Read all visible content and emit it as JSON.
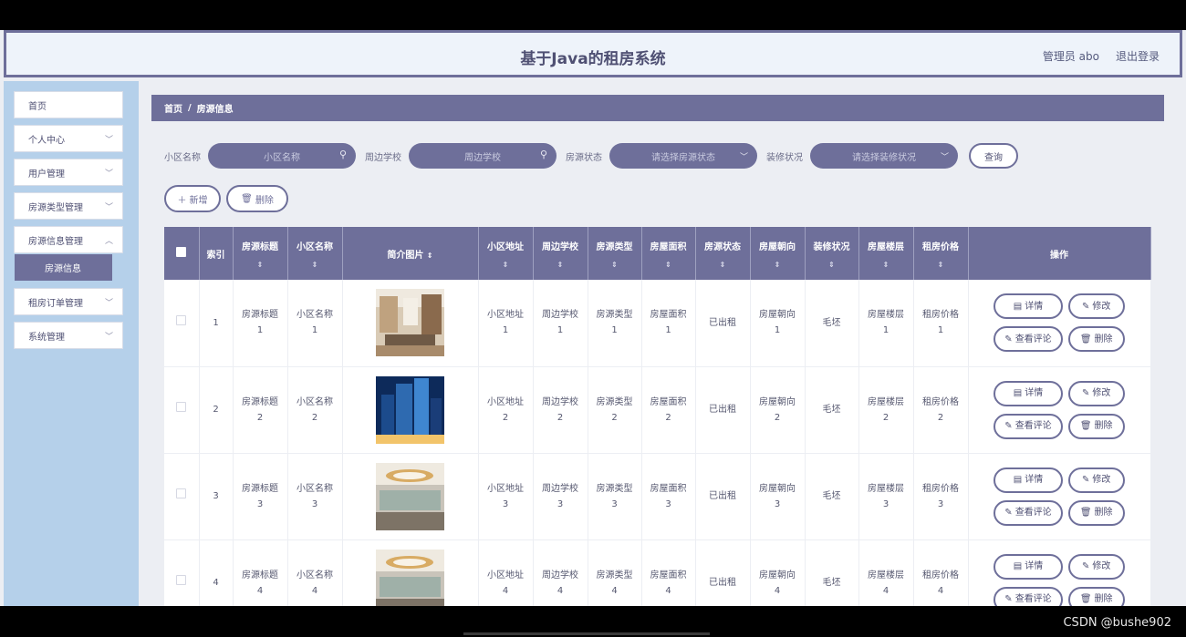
{
  "header": {
    "title": "基于Java的租房系统",
    "user_label": "管理员 abo",
    "logout_label": "退出登录"
  },
  "sidebar": {
    "items": [
      {
        "label": "首页",
        "has_chevron": false
      },
      {
        "label": "个人中心",
        "has_chevron": true
      },
      {
        "label": "用户管理",
        "has_chevron": true
      },
      {
        "label": "房源类型管理",
        "has_chevron": true
      },
      {
        "label": "房源信息管理",
        "has_chevron": true
      },
      {
        "label": "租房订单管理",
        "has_chevron": true
      },
      {
        "label": "系统管理",
        "has_chevron": true
      }
    ],
    "active_sub": "房源信息"
  },
  "breadcrumb": {
    "home": "首页",
    "separator": "/",
    "current": "房源信息"
  },
  "search": {
    "community_label": "小区名称",
    "community_placeholder": "小区名称",
    "school_label": "周边学校",
    "school_placeholder": "周边学校",
    "status_label": "房源状态",
    "status_placeholder": "请选择房源状态",
    "decor_label": "装修状况",
    "decor_placeholder": "请选择装修状况",
    "query_label": "查询"
  },
  "actions": {
    "add_label": "新增",
    "delete_label": "删除"
  },
  "table": {
    "headers": {
      "index": "索引",
      "title": "房源标题",
      "community": "小区名称",
      "image": "简介图片",
      "address": "小区地址",
      "school": "周边学校",
      "type": "房源类型",
      "area": "房屋面积",
      "status": "房源状态",
      "orientation": "房屋朝向",
      "decor": "装修状况",
      "floor": "房屋楼层",
      "price": "租房价格",
      "ops": "操作"
    },
    "ops_labels": {
      "detail": "详情",
      "edit": "修改",
      "comments": "查看评论",
      "delete": "删除"
    },
    "rows": [
      {
        "index": "1",
        "title": "房源标题",
        "title_n": "1",
        "community": "小区名称",
        "community_n": "1",
        "address": "小区地址",
        "address_n": "1",
        "school": "周边学校",
        "school_n": "1",
        "type": "房源类型",
        "type_n": "1",
        "area": "房屋面积",
        "area_n": "1",
        "status": "已出租",
        "orientation": "房屋朝向",
        "orientation_n": "1",
        "decor": "毛坯",
        "floor": "房屋楼层",
        "floor_n": "1",
        "price": "租房价格",
        "price_n": "1",
        "image": "living-room-photo"
      },
      {
        "index": "2",
        "title": "房源标题",
        "title_n": "2",
        "community": "小区名称",
        "community_n": "2",
        "address": "小区地址",
        "address_n": "2",
        "school": "周边学校",
        "school_n": "2",
        "type": "房源类型",
        "type_n": "2",
        "area": "房屋面积",
        "area_n": "2",
        "status": "已出租",
        "orientation": "房屋朝向",
        "orientation_n": "2",
        "decor": "毛坯",
        "floor": "房屋楼层",
        "floor_n": "2",
        "price": "租房价格",
        "price_n": "2",
        "image": "skyscraper-photo"
      },
      {
        "index": "3",
        "title": "房源标题",
        "title_n": "3",
        "community": "小区名称",
        "community_n": "3",
        "address": "小区地址",
        "address_n": "3",
        "school": "周边学校",
        "school_n": "3",
        "type": "房源类型",
        "type_n": "3",
        "area": "房屋面积",
        "area_n": "3",
        "status": "已出租",
        "orientation": "房屋朝向",
        "orientation_n": "3",
        "decor": "毛坯",
        "floor": "房屋楼层",
        "floor_n": "3",
        "price": "租房价格",
        "price_n": "3",
        "image": "office-interior-photo"
      },
      {
        "index": "4",
        "title": "房源标题",
        "title_n": "4",
        "community": "小区名称",
        "community_n": "4",
        "address": "小区地址",
        "address_n": "4",
        "school": "周边学校",
        "school_n": "4",
        "type": "房源类型",
        "type_n": "4",
        "area": "房屋面积",
        "area_n": "4",
        "status": "已出租",
        "orientation": "房屋朝向",
        "orientation_n": "4",
        "decor": "毛坯",
        "floor": "房屋楼层",
        "floor_n": "4",
        "price": "租房价格",
        "price_n": "4",
        "image": "office-interior-photo"
      }
    ]
  },
  "watermark": "CSDN @bushe902",
  "colors": {
    "primary": "#6e6f9a",
    "sidebar_bg": "#b5d0ea",
    "header_bg": "#eef3fa",
    "page_bg": "#eceef3"
  }
}
